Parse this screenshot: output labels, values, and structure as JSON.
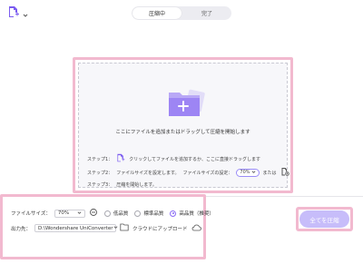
{
  "header": {
    "tabs": [
      {
        "label": "圧縮中",
        "active": true
      },
      {
        "label": "完了",
        "active": false
      }
    ]
  },
  "dropzone": {
    "main_text": "ここにファイルを追加またはドラッグして圧縮を開始します",
    "step1_label": "ステップ1：",
    "step1_text": "クリックしてファイルを追加するか、ここに直接ドラッグします",
    "step2_label": "ステップ2：",
    "step2_text": "ファイルサイズを設定します。",
    "step2_setting_label": "ファイルサイズの設定：",
    "step2_value": "70%",
    "step2_or": "または",
    "step3_label": "ステップ3：",
    "step3_text": "圧縮を開始します。"
  },
  "bottom": {
    "file_size_label": "ファイルサイズ：",
    "file_size_value": "70%",
    "quality_options": [
      {
        "label": "低品質",
        "selected": false
      },
      {
        "label": "標準品質",
        "selected": false
      },
      {
        "label": "高品質（推奨）",
        "selected": true
      }
    ],
    "output_label": "出力先：",
    "output_path": "D:\\Wondershare UniConverter",
    "cloud_upload_label": "クラウドにアップロード",
    "compress_all_label": "全てを圧縮"
  },
  "colors": {
    "accent": "#8a6cf5",
    "highlight_border": "#f2b9cf",
    "button_disabled": "#c7bdfa"
  }
}
